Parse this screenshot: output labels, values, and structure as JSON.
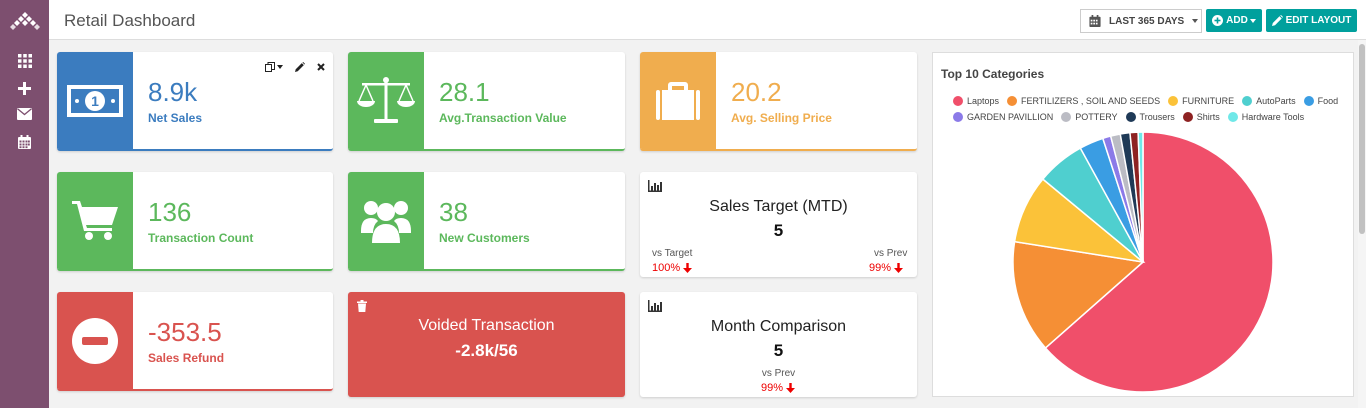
{
  "header": {
    "title": "Retail Dashboard",
    "date_range_label": "LAST 365 DAYS",
    "add_label": "ADD",
    "edit_layout_label": "EDIT LAYOUT"
  },
  "colors": {
    "sidebar": "#7d4f6f",
    "teal": "#00a09d",
    "blue": "#3b7cbf",
    "green": "#5cb85c",
    "orange": "#f0ad4e",
    "red": "#d9534f"
  },
  "sidebar": {
    "items": [
      {
        "icon": "grid-icon"
      },
      {
        "icon": "plus-icon"
      },
      {
        "icon": "envelope-icon"
      },
      {
        "icon": "calendar-icon"
      }
    ]
  },
  "kpis": {
    "net_sales": {
      "value": "8.9k",
      "label": "Net Sales",
      "icon": "money-icon"
    },
    "avg_transaction": {
      "value": "28.1",
      "label": "Avg.Transaction Value",
      "icon": "scale-icon"
    },
    "avg_selling": {
      "value": "20.2",
      "label": "Avg. Selling Price",
      "icon": "briefcase-icon"
    },
    "transaction_count": {
      "value": "136",
      "label": "Transaction Count",
      "icon": "cart-icon"
    },
    "new_customers": {
      "value": "38",
      "label": "New Customers",
      "icon": "users-icon"
    },
    "sales_refund": {
      "value": "-353.5",
      "label": "Sales Refund",
      "icon": "minus-circle-icon"
    }
  },
  "voided": {
    "title": "Voided Transaction",
    "value": "-2.8k/56"
  },
  "sales_target": {
    "title": "Sales Target (MTD)",
    "value": "5",
    "vs_target_label": "vs Target",
    "vs_target_value": "100%",
    "vs_prev_label": "vs Prev",
    "vs_prev_value": "99%"
  },
  "month_comparison": {
    "title": "Month Comparison",
    "value": "5",
    "vs_prev_label": "vs Prev",
    "vs_prev_value": "99%"
  },
  "chart_data": {
    "type": "pie",
    "title": "Top 10 Categories",
    "legend_position": "top",
    "categories": [
      "Laptops",
      "FERTILIZERS , SOIL AND SEEDS",
      "FURNITURE",
      "AutoParts",
      "Food",
      "GARDEN PAVILLION",
      "POTTERY",
      "Trousers",
      "Shirts",
      "Hardware Tools"
    ],
    "values": [
      63.5,
      14,
      8.5,
      6,
      3,
      1,
      1.2,
      1.2,
      1,
      0.6
    ],
    "colors": [
      "#f04f6a",
      "#f58f35",
      "#fbc239",
      "#4fcfcf",
      "#3a9de3",
      "#8b7ae8",
      "#bbbcc4",
      "#1f3a57",
      "#8e2222",
      "#6fe8e8"
    ]
  }
}
